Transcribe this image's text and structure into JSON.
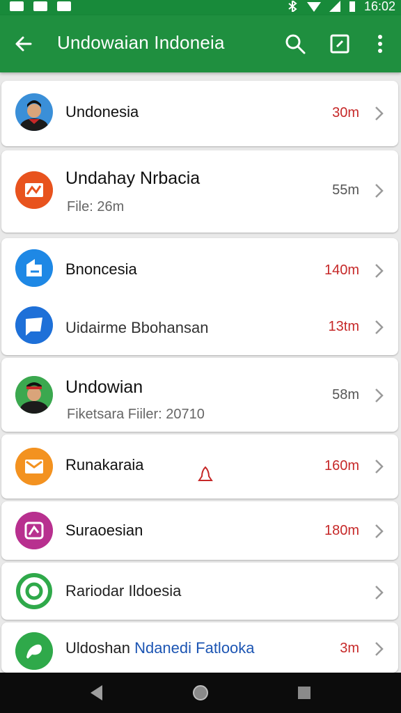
{
  "status_bar": {
    "time": "16:02"
  },
  "appbar": {
    "title": "Undowaian Indoneia"
  },
  "items": [
    {
      "name": "Undonesia",
      "time": "30m"
    },
    {
      "name": "Undahay Nrbacia",
      "subtitle": "File: 26m",
      "time": "55m"
    },
    {
      "name": "Bnoncesia",
      "time": "140m"
    },
    {
      "name": "Uidairme Bbohansan",
      "time": "13tm"
    },
    {
      "name": "Undowian",
      "subtitle": "Fiketsara Fiiler: 20710",
      "time": "58m"
    },
    {
      "name": "Runakaraia",
      "time": "160m"
    },
    {
      "name": "Suraoesian",
      "time": "180m"
    },
    {
      "name": "Rariodar Ildoesia",
      "time": ""
    },
    {
      "name_part1": "Uldoshan",
      "name_part2": "Ndanedi Fatlooka",
      "time": "3m"
    }
  ],
  "colors": {
    "appbar": "#1f8f3f",
    "accent_red": "#c62828"
  }
}
